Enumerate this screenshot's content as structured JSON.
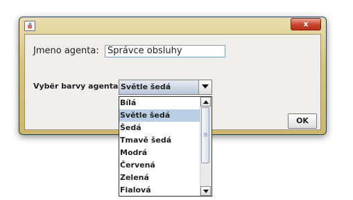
{
  "dialog": {
    "close_symbol": "x",
    "app_icon": "java-app-icon"
  },
  "form": {
    "name_label": "Jmeno agenta:",
    "name_value": "Správce obsluhy",
    "color_label": "Vybër barvy agenta:",
    "ok_label": "OK"
  },
  "combo": {
    "selected": "Světle šedá",
    "options": [
      "Bílá",
      "Světle šedá",
      "Šedá",
      "Tmavě šedá",
      "Modrá",
      "Červená",
      "Zelená",
      "Fialová"
    ],
    "highlighted_index": 1
  }
}
